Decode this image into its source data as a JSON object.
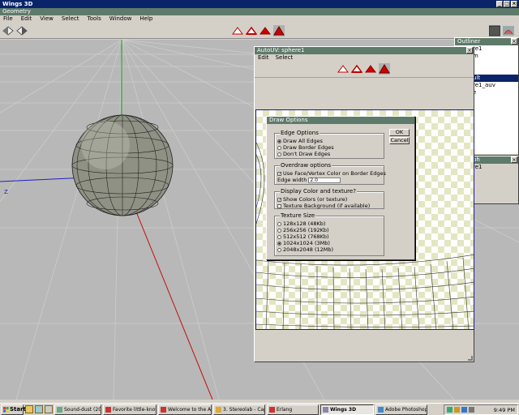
{
  "window": {
    "title": "Wings 3D"
  },
  "geometry_header": "Geometry",
  "menu": [
    "File",
    "Edit",
    "View",
    "Select",
    "Tools",
    "Window",
    "Help"
  ],
  "viewport": {
    "axis_label": "Z"
  },
  "outliner": {
    "title": "Outliner",
    "items": [
      "re1",
      "m",
      "",
      "",
      "ult",
      "re1_auv",
      "e"
    ],
    "selected_index": 4
  },
  "geom_graph": {
    "title": "y Graph",
    "items": [
      "re1"
    ]
  },
  "autouv": {
    "title": "AutoUV: sphere1",
    "menu": [
      "Edit",
      "Select"
    ]
  },
  "dialog": {
    "title": "Draw Options",
    "ok": "OK",
    "cancel": "Cancel",
    "edge_options": {
      "title": "Edge Options",
      "items": [
        "Draw All Edges",
        "Draw Border Edges",
        "Don't Draw Edges"
      ],
      "selected": 0
    },
    "overdraw": {
      "title": "Overdraw options",
      "use_face_color": "Use Face/Vertex Color on Border Edges",
      "edge_width_label": "Edge width",
      "edge_width_value": "2.0"
    },
    "display": {
      "title": "Display Color and texture?",
      "show_colors": "Show Colors (or texture)",
      "texture_bg": "Texture Background (if available)"
    },
    "texture_size": {
      "title": "Texture Size",
      "items": [
        "128x128 (48Kb)",
        "256x256 (192Kb)",
        "512x512 (768Kb)",
        "1024x1024 (3Mb)",
        "2048x2048 (12Mb)"
      ],
      "selected": 3
    }
  },
  "taskbar": {
    "start": "Start",
    "tasks": [
      "Sound-dust (2001)",
      "Favorite little-know...",
      "Welcome to the Art ...",
      "3. Stereolab - Capt...",
      "Erlang",
      "Wings 3D",
      "Adobe Photoshop"
    ],
    "active": "Wings 3D",
    "clock": "9:49 PM"
  },
  "colors": {
    "title_bar": "#0a246a",
    "panel_header": "#5e7a6a",
    "face": "#8e9184",
    "uv_checker": "#e4e6c2"
  }
}
